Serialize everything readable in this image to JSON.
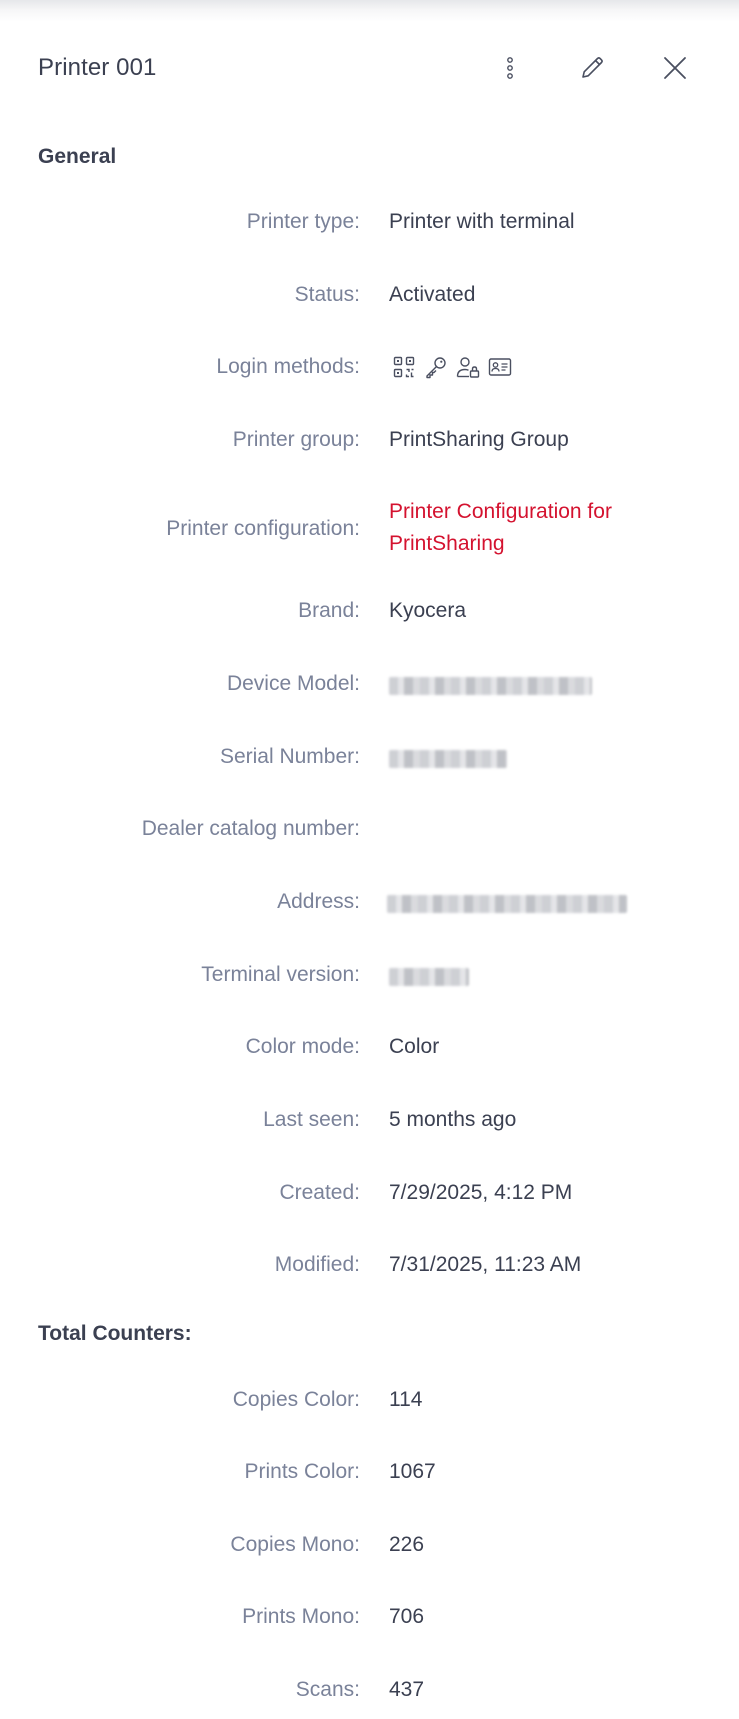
{
  "panel": {
    "title": "Printer 001"
  },
  "header_actions": {
    "more_icon": "more-vertical-icon",
    "edit_icon": "pencil-icon",
    "close_icon": "close-icon"
  },
  "general": {
    "title": "General",
    "printer_type": {
      "label": "Printer type:",
      "value": "Printer with terminal"
    },
    "status": {
      "label": "Status:",
      "value": "Activated"
    },
    "login_methods": {
      "label": "Login methods:",
      "icons": [
        "qr-code-icon",
        "key-icon",
        "user-lock-icon",
        "id-card-icon"
      ]
    },
    "printer_group": {
      "label": "Printer group:",
      "value": "PrintSharing Group"
    },
    "printer_configuration": {
      "label": "Printer configuration:",
      "value": "Printer Configuration for PrintSharing"
    },
    "brand": {
      "label": "Brand:",
      "value": "Kyocera"
    },
    "device_model": {
      "label": "Device Model:",
      "value": ""
    },
    "serial_number": {
      "label": "Serial Number:",
      "value": ""
    },
    "dealer_catalog_number": {
      "label": "Dealer catalog number:",
      "value": ""
    },
    "address": {
      "label": "Address:",
      "value": ""
    },
    "terminal_version": {
      "label": "Terminal version:",
      "value": ""
    },
    "color_mode": {
      "label": "Color mode:",
      "value": "Color"
    },
    "last_seen": {
      "label": "Last seen:",
      "value": "5 months ago"
    },
    "created": {
      "label": "Created:",
      "value": "7/29/2025, 4:12 PM"
    },
    "modified": {
      "label": "Modified:",
      "value": "7/31/2025, 11:23 AM"
    }
  },
  "counters": {
    "title": "Total Counters:",
    "copies_color": {
      "label": "Copies Color:",
      "value": "114"
    },
    "prints_color": {
      "label": "Prints Color:",
      "value": "1067"
    },
    "copies_mono": {
      "label": "Copies Mono:",
      "value": "226"
    },
    "prints_mono": {
      "label": "Prints Mono:",
      "value": "706"
    },
    "scans": {
      "label": "Scans:",
      "value": "437"
    }
  },
  "colors": {
    "text": "#3b4051",
    "label": "#7a8299",
    "link": "#d4122f",
    "background": "#ffffff"
  }
}
